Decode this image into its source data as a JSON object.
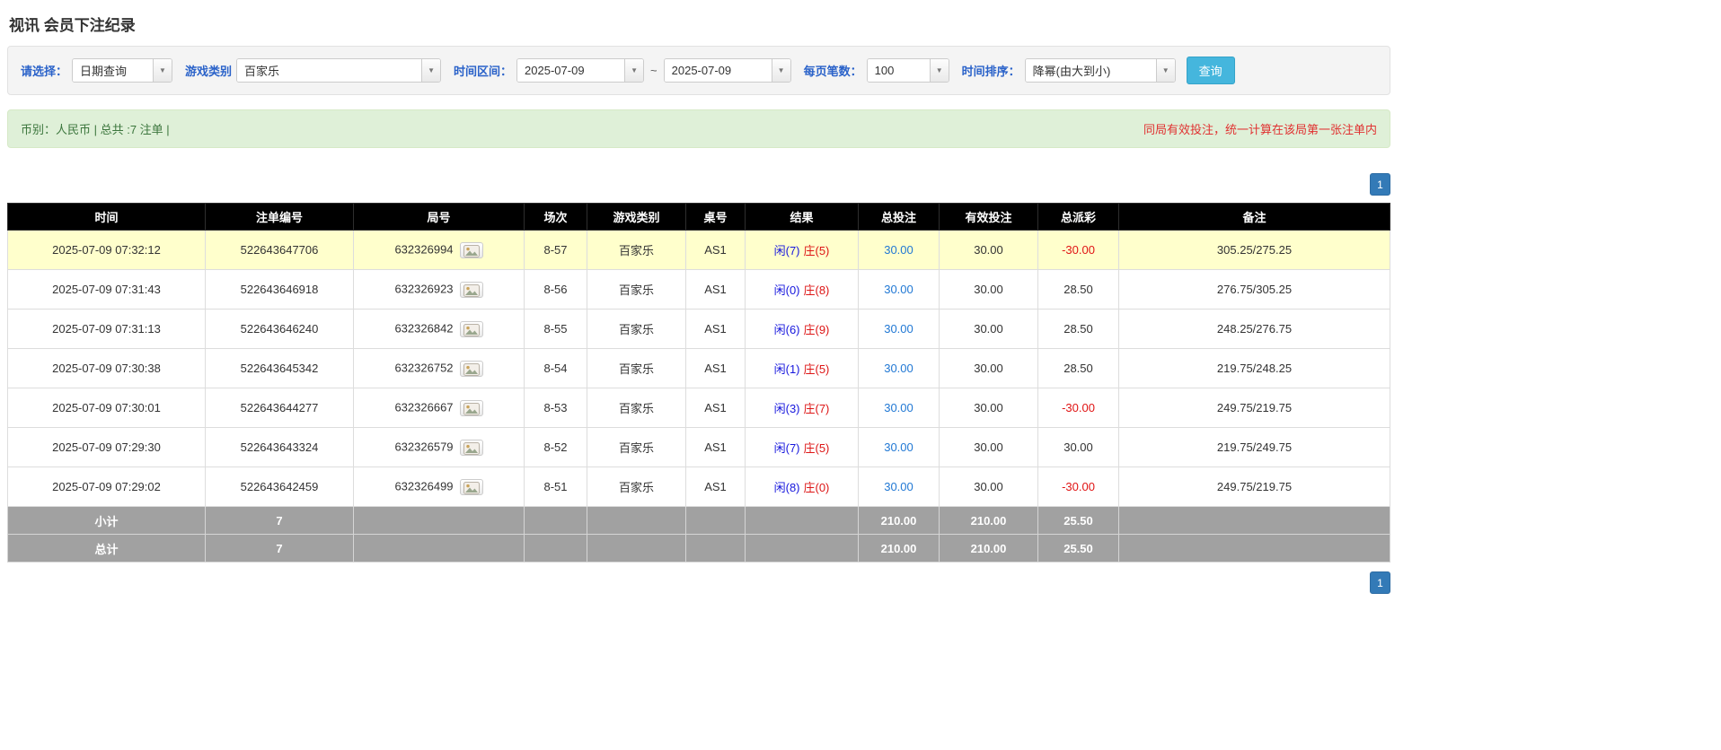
{
  "page_title": "视讯 会员下注纪录",
  "icons": {
    "dropdown_arrow": "▼",
    "round_media": "photo-icon"
  },
  "colors": {
    "accent_blue": "#337ab7",
    "search_button_blue": "#45b6dd",
    "player_blue": "#1616dd",
    "banker_red": "#dd1616",
    "negative_red": "#e01414",
    "highlight_row_yellow": "#ffffcc",
    "table_header_bg": "#000000",
    "summary_row_bg": "#a1a1a1",
    "info_bar_bg": "#dff0d8",
    "info_text_green": "#3c763d",
    "warning_red": "#e03131"
  },
  "filters": {
    "select_label": "请选择：",
    "select_value": "日期查询",
    "game_type_label": "游戏类别",
    "game_type_value": "百家乐",
    "time_range_label": "时间区间：",
    "date_from": "2025-07-09",
    "range_separator": "~",
    "date_to": "2025-07-09",
    "per_page_label": "每页笔数：",
    "per_page_value": "100",
    "sort_label": "时间排序：",
    "sort_value": "降幂(由大到小)",
    "search_button": "查询"
  },
  "info_bar": {
    "left": "币别：人民币 | 总共 :7 注单 |",
    "right": "同局有效投注，统一计算在该局第一张注单内"
  },
  "pagination": {
    "current_page": "1"
  },
  "table": {
    "headers": [
      "时间",
      "注单编号",
      "局号",
      "场次",
      "游戏类别",
      "桌号",
      "结果",
      "总投注",
      "有效投注",
      "总派彩",
      "备注"
    ],
    "rows": [
      {
        "time": "2025-07-09 07:32:12",
        "bet_id": "522643647706",
        "round_id": "632326994",
        "session": "8-57",
        "game": "百家乐",
        "table_no": "AS1",
        "result_player": "闲(7)",
        "result_banker": "庄(5)",
        "total_bet": "30.00",
        "valid_bet": "30.00",
        "payout": "-30.00",
        "note": "305.25/275.25",
        "highlighted": true
      },
      {
        "time": "2025-07-09 07:31:43",
        "bet_id": "522643646918",
        "round_id": "632326923",
        "session": "8-56",
        "game": "百家乐",
        "table_no": "AS1",
        "result_player": "闲(0)",
        "result_banker": "庄(8)",
        "total_bet": "30.00",
        "valid_bet": "30.00",
        "payout": "28.50",
        "note": "276.75/305.25",
        "highlighted": false
      },
      {
        "time": "2025-07-09 07:31:13",
        "bet_id": "522643646240",
        "round_id": "632326842",
        "session": "8-55",
        "game": "百家乐",
        "table_no": "AS1",
        "result_player": "闲(6)",
        "result_banker": "庄(9)",
        "total_bet": "30.00",
        "valid_bet": "30.00",
        "payout": "28.50",
        "note": "248.25/276.75",
        "highlighted": false
      },
      {
        "time": "2025-07-09 07:30:38",
        "bet_id": "522643645342",
        "round_id": "632326752",
        "session": "8-54",
        "game": "百家乐",
        "table_no": "AS1",
        "result_player": "闲(1)",
        "result_banker": "庄(5)",
        "total_bet": "30.00",
        "valid_bet": "30.00",
        "payout": "28.50",
        "note": "219.75/248.25",
        "highlighted": false
      },
      {
        "time": "2025-07-09 07:30:01",
        "bet_id": "522643644277",
        "round_id": "632326667",
        "session": "8-53",
        "game": "百家乐",
        "table_no": "AS1",
        "result_player": "闲(3)",
        "result_banker": "庄(7)",
        "total_bet": "30.00",
        "valid_bet": "30.00",
        "payout": "-30.00",
        "note": "249.75/219.75",
        "highlighted": false
      },
      {
        "time": "2025-07-09 07:29:30",
        "bet_id": "522643643324",
        "round_id": "632326579",
        "session": "8-52",
        "game": "百家乐",
        "table_no": "AS1",
        "result_player": "闲(7)",
        "result_banker": "庄(5)",
        "total_bet": "30.00",
        "valid_bet": "30.00",
        "payout": "30.00",
        "note": "219.75/249.75",
        "highlighted": false
      },
      {
        "time": "2025-07-09 07:29:02",
        "bet_id": "522643642459",
        "round_id": "632326499",
        "session": "8-51",
        "game": "百家乐",
        "table_no": "AS1",
        "result_player": "闲(8)",
        "result_banker": "庄(0)",
        "total_bet": "30.00",
        "valid_bet": "30.00",
        "payout": "-30.00",
        "note": "249.75/219.75",
        "highlighted": false
      }
    ],
    "summary_rows": [
      {
        "label": "小计",
        "count": "7",
        "total_bet": "210.00",
        "valid_bet": "210.00",
        "payout": "25.50"
      },
      {
        "label": "总计",
        "count": "7",
        "total_bet": "210.00",
        "valid_bet": "210.00",
        "payout": "25.50"
      }
    ]
  }
}
